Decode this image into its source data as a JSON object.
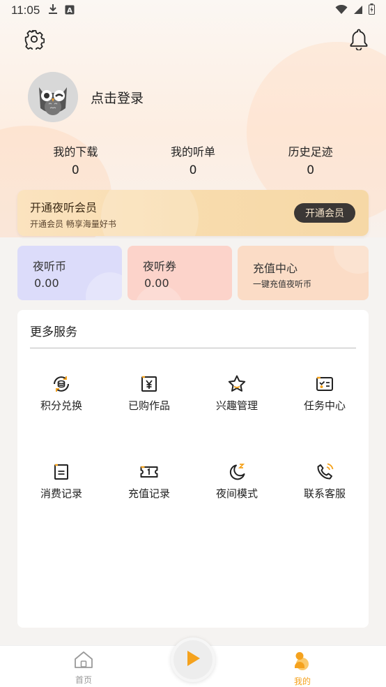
{
  "status_bar": {
    "time": "11:05",
    "icons_left": [
      "download-icon",
      "keyboard-a-icon"
    ],
    "icons_right": [
      "wifi-icon",
      "signal-icon",
      "battery-icon"
    ]
  },
  "header": {
    "settings_icon": "gear-icon",
    "bell_icon": "bell-icon"
  },
  "profile": {
    "login_text": "点击登录",
    "avatar_icon": "owl-avatar-icon"
  },
  "stats": [
    {
      "label": "我的下载",
      "value": "0"
    },
    {
      "label": "我的听单",
      "value": "0"
    },
    {
      "label": "历史足迹",
      "value": "0"
    }
  ],
  "vip": {
    "title": "开通夜听会员",
    "subtitle": "开通会员 畅享海量好书",
    "button": "开通会员"
  },
  "wallet": {
    "coins": {
      "title": "夜听币",
      "value": "0.00"
    },
    "vouchers": {
      "title": "夜听券",
      "value": "0.00"
    },
    "recharge": {
      "title": "充值中心",
      "subtitle": "一键充值夜听币"
    }
  },
  "services": {
    "title": "更多服务",
    "items": [
      {
        "label": "积分兑换",
        "icon": "points-exchange-icon"
      },
      {
        "label": "已购作品",
        "icon": "purchased-works-icon"
      },
      {
        "label": "兴趣管理",
        "icon": "star-icon"
      },
      {
        "label": "任务中心",
        "icon": "task-icon"
      },
      {
        "label": "消费记录",
        "icon": "receipt-icon"
      },
      {
        "label": "充值记录",
        "icon": "ticket-icon"
      },
      {
        "label": "夜间模式",
        "icon": "moon-icon"
      },
      {
        "label": "联系客服",
        "icon": "phone-icon"
      }
    ]
  },
  "tabbar": {
    "home": "首页",
    "mine": "我的",
    "play_icon": "play-icon"
  },
  "colors": {
    "accent": "#f5a21d",
    "vip_button_bg": "#3b3735",
    "coins_card": "#dcdcfa",
    "vouchers_card": "#fcd3ca",
    "recharge_card": "#fbdcc6"
  }
}
